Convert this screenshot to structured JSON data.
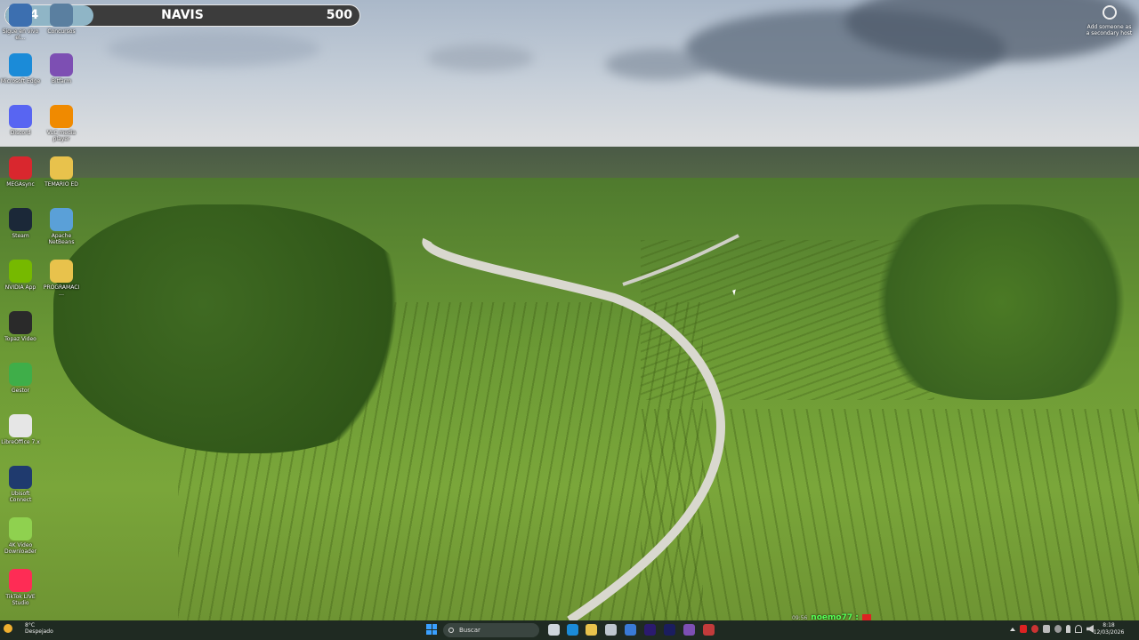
{
  "navis_bar": {
    "left_value": "124",
    "title": "NAVIS",
    "right_value": "500",
    "progress": 0.248,
    "fill_color": "#8fb5c6"
  },
  "desktop_icons": [
    {
      "name": "Sigue En Vivo",
      "label": "Sigue en vivo el…",
      "icon": "app-icon",
      "color": "#3c6fb0"
    },
    {
      "name": "Concursos",
      "label": "Concursos",
      "icon": "app-icon",
      "color": "#5a7fa0"
    },
    {
      "name": "Microsoft Edge",
      "label": "Microsoft Edge",
      "icon": "edge-icon",
      "color": "#1b8bd8"
    },
    {
      "name": "Bitfarm",
      "label": "Bitfarm",
      "icon": "bitfarm-icon",
      "color": "#7d4fb3"
    },
    {
      "name": "Discord",
      "label": "Discord",
      "icon": "discord-icon",
      "color": "#5865f2"
    },
    {
      "name": "VLC media player",
      "label": "VLC media player",
      "icon": "vlc-icon",
      "color": "#f08a00"
    },
    {
      "name": "MEGAsync",
      "label": "MEGAsync",
      "icon": "mega-icon",
      "color": "#d9272e"
    },
    {
      "name": "TEMARIO ED",
      "label": "TEMARIO ED",
      "icon": "folder-icon",
      "color": "#e8c24c"
    },
    {
      "name": "Steam",
      "label": "Steam",
      "icon": "steam-icon",
      "color": "#1b2838"
    },
    {
      "name": "Apache NetBeans",
      "label": "Apache NetBeans",
      "icon": "netbeans-icon",
      "color": "#5aa0d8"
    },
    {
      "name": "NVIDIA App",
      "label": "NVIDIA App",
      "icon": "nvidia-icon",
      "color": "#76b900"
    },
    {
      "name": "PROGRAMACI…",
      "label": "PROGRAMACI…",
      "icon": "folder-icon",
      "color": "#e8c24c"
    },
    {
      "name": "Topaz Video",
      "label": "Topaz Video",
      "icon": "topaz-icon",
      "color": "#2a2a2a"
    },
    {
      "name": "Gestor",
      "label": "Gestor",
      "icon": "green-app-icon",
      "color": "#3fae49"
    },
    {
      "name": "LibreOffice 7.x",
      "label": "LibreOffice 7.x",
      "icon": "file-icon",
      "color": "#e6e6e6"
    },
    {
      "name": "Ubisoft Connect",
      "label": "Ubisoft Connect",
      "icon": "ubisoft-icon",
      "color": "#1f3a6e"
    },
    {
      "name": "4K Video Downloader",
      "label": "4K Video Downloader",
      "icon": "cloud-icon",
      "color": "#8fd14f"
    },
    {
      "name": "TikTok LIVE Studio",
      "label": "TikTok LIVE Studio",
      "icon": "tiktok-icon",
      "color": "#fe2c55"
    }
  ],
  "top_right_icon": {
    "label": "Add someone as a secondary host",
    "icon": "aperture-icon"
  },
  "chat_overlay": {
    "timestamp": "09:56",
    "username": "noemo77 :"
  },
  "taskbar": {
    "weather_temp": "8°C",
    "weather_desc": "Despejado",
    "search_placeholder": "Buscar",
    "time": "8:18",
    "date": "12/03/2026",
    "apps": [
      {
        "name": "task-view",
        "color": "#cfd6dc"
      },
      {
        "name": "edge",
        "color": "#1b8bd8"
      },
      {
        "name": "file-explorer",
        "color": "#e8c24c"
      },
      {
        "name": "store",
        "color": "#bfc7cf"
      },
      {
        "name": "app-blue",
        "color": "#3a7ad6"
      },
      {
        "name": "after-effects",
        "color": "#2b1a6e"
      },
      {
        "name": "media-encoder",
        "color": "#1b1d5e"
      },
      {
        "name": "app-purple",
        "color": "#7d4fb3"
      },
      {
        "name": "app-record",
        "color": "#c23b3b"
      }
    ]
  }
}
